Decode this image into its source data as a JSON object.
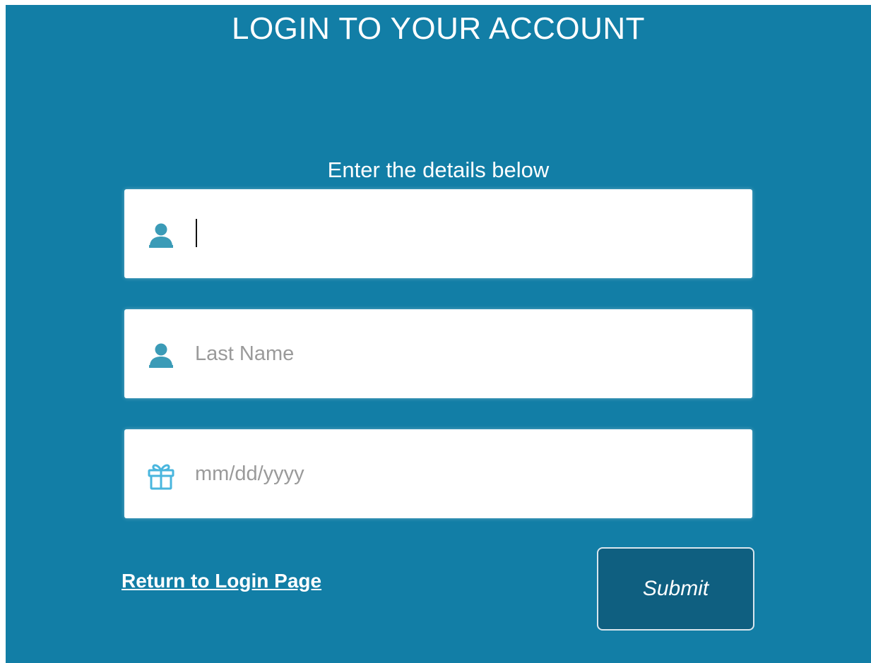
{
  "header": {
    "title": "LOGIN TO YOUR ACCOUNT"
  },
  "form": {
    "instructions": "Enter the details below",
    "first_name": {
      "value": "",
      "placeholder": "",
      "icon": "user-icon"
    },
    "last_name": {
      "value": "",
      "placeholder": "Last Name",
      "icon": "user-icon"
    },
    "birth_date": {
      "value": "",
      "placeholder": "mm/dd/yyyy",
      "icon": "gift-icon"
    },
    "return_link_label": "Return to Login Page",
    "submit_label": "Submit"
  },
  "colors": {
    "background": "#127ea6",
    "submit_background": "#0f5f80",
    "icon_user": "#3b9bb7",
    "icon_gift": "#49b6de"
  }
}
